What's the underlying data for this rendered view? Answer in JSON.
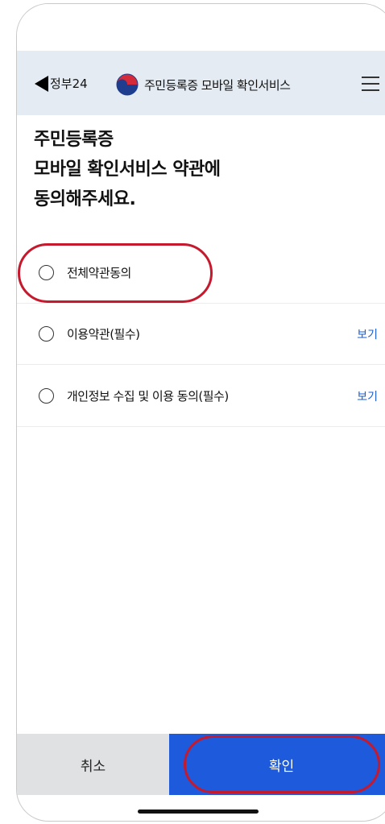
{
  "header": {
    "back_label": "정부24",
    "title": "주민등록증 모바일 확인서비스"
  },
  "page": {
    "title_lines": [
      "주민등록증",
      "모바일 확인서비스 약관에",
      "동의해주세요."
    ]
  },
  "agreements": {
    "all": {
      "label": "전체약관동의"
    },
    "items": [
      {
        "label": "이용약관(필수)",
        "view_label": "보기"
      },
      {
        "label": "개인정보 수집 및 이용 동의(필수)",
        "view_label": "보기"
      }
    ]
  },
  "footer": {
    "cancel_label": "취소",
    "confirm_label": "확인"
  },
  "colors": {
    "header_bg": "#e4ebf3",
    "confirm_bg": "#1e5bdc",
    "cancel_bg": "#e0e1e2",
    "highlight": "#c5192d",
    "link": "#1a5fd6"
  }
}
